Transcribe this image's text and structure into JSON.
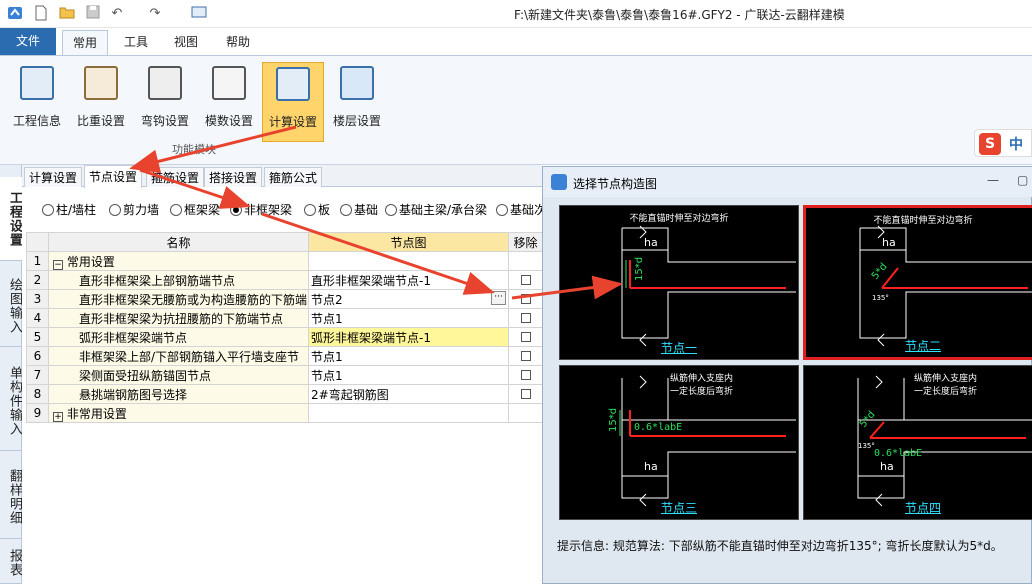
{
  "window_title": "F:\\新建文件夹\\泰鲁\\泰鲁\\泰鲁16#.GFY2 - 广联达-云翻样建模",
  "ribbon_tabs": [
    "文件",
    "常用",
    "工具",
    "视图",
    "帮助"
  ],
  "ribbon_buttons": [
    "工程信息",
    "比重设置",
    "弯钩设置",
    "模数设置",
    "计算设置",
    "楼层设置"
  ],
  "ribbon_group_label": "功能模块",
  "ime_label": "中",
  "sidebar_tabs": [
    "工程设置",
    "绘图输入",
    "单构件输入",
    "翻样明细",
    "报表"
  ],
  "settings_tabs": [
    "计算设置",
    "节点设置",
    "箍筋设置",
    "搭接设置",
    "箍筋公式"
  ],
  "member_types": [
    "柱/墙柱",
    "剪力墙",
    "框架梁",
    "非框架梁",
    "板",
    "基础",
    "基础主梁/承台梁",
    "基础次梁"
  ],
  "selected_member_type": "非框架梁",
  "grid": {
    "columns": [
      "名称",
      "节点图",
      "移除"
    ],
    "rows": [
      {
        "no": "1",
        "name": "常用设置",
        "value": "",
        "group": true,
        "toggle": "−"
      },
      {
        "no": "2",
        "name": "直形非框架梁上部钢筋端节点",
        "value": "直形非框架梁端节点-1"
      },
      {
        "no": "3",
        "name": "直形非框架梁无腰筋或为构造腰筋的下筋端",
        "value": "节点2",
        "editing": true
      },
      {
        "no": "4",
        "name": "直形非框架梁为抗扭腰筋的下筋端节点",
        "value": "节点1"
      },
      {
        "no": "5",
        "name": "弧形非框架梁端节点",
        "value": "弧形非框架梁端节点-1",
        "highlight": true
      },
      {
        "no": "6",
        "name": "非框架梁上部/下部钢筋锚入平行墙支座节",
        "value": "节点1"
      },
      {
        "no": "7",
        "name": "梁侧面受扭纵筋锚固节点",
        "value": "节点1"
      },
      {
        "no": "8",
        "name": "悬挑端钢筋图号选择",
        "value": "2#弯起钢筋图"
      },
      {
        "no": "9",
        "name": "非常用设置",
        "value": "",
        "group": true,
        "toggle": "+"
      }
    ]
  },
  "dialog": {
    "title": "选择节点构造图",
    "panels": [
      {
        "caption": "不能直锚时伸至对边弯折",
        "label": "节点一",
        "dim_ha": "ha",
        "dim_text": "15*d",
        "selected": false
      },
      {
        "caption": "不能直锚时伸至对边弯折",
        "label": "节点二",
        "dim_ha": "ha",
        "dim_text": "5*d",
        "angle": "135°",
        "selected": true
      },
      {
        "caption": "纵筋伸入支座内\n一定长度后弯折",
        "label": "节点三",
        "dim_ha": "ha",
        "dim_text": "15*d",
        "lab_text": "0.6*labE",
        "selected": false
      },
      {
        "caption": "纵筋伸入支座内\n一定长度后弯折",
        "label": "节点四",
        "dim_ha": "ha",
        "dim_text": "5*d",
        "angle": "135°",
        "lab_text": "0.6*labE",
        "selected": false
      }
    ],
    "tip": "提示信息: 规范算法: 下部纵筋不能直锚时伸至对边弯折135°; 弯折长度默认为5*d。"
  },
  "colors": {
    "accent": "#2b6cb0",
    "arrow": "#e8432e",
    "selected_ribbon": "#ffd56b",
    "highlight_cell": "#fff79a"
  }
}
